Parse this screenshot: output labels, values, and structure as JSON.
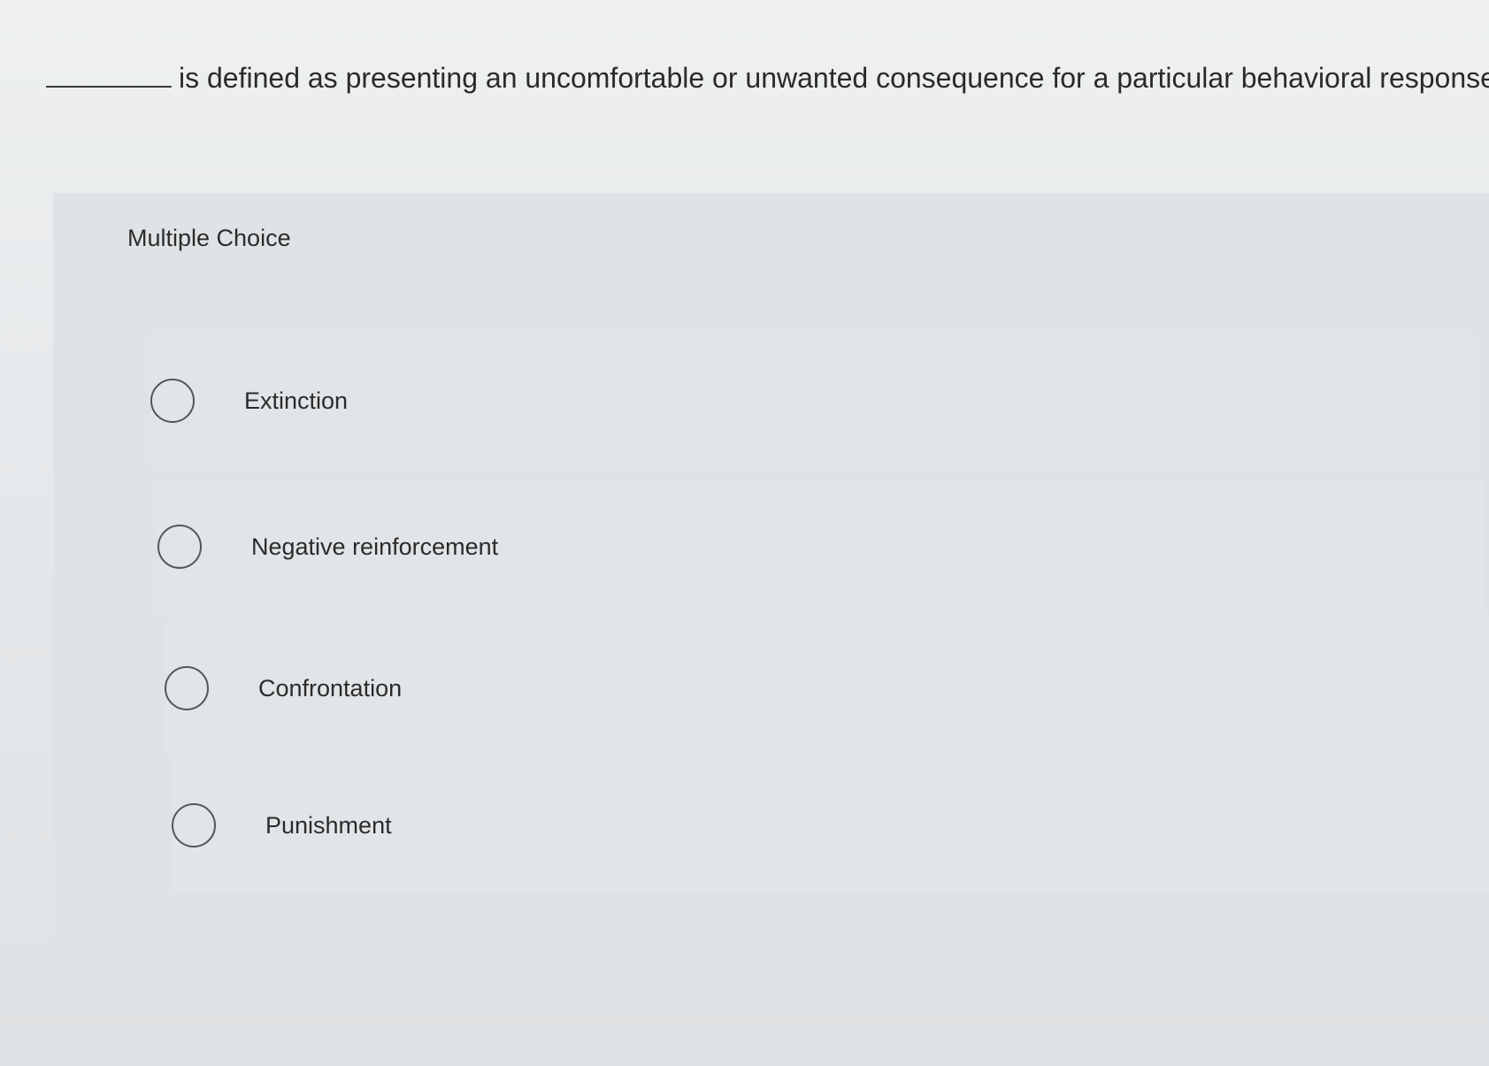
{
  "question": {
    "text": "is defined as presenting an uncomfortable or unwanted consequence for a particular behavioral response."
  },
  "panel": {
    "header": "Multiple Choice",
    "options": [
      {
        "label": "Extinction"
      },
      {
        "label": "Negative reinforcement"
      },
      {
        "label": "Confrontation"
      },
      {
        "label": "Punishment"
      }
    ]
  },
  "icons": {
    "radio": "radio-unselected-icon"
  }
}
